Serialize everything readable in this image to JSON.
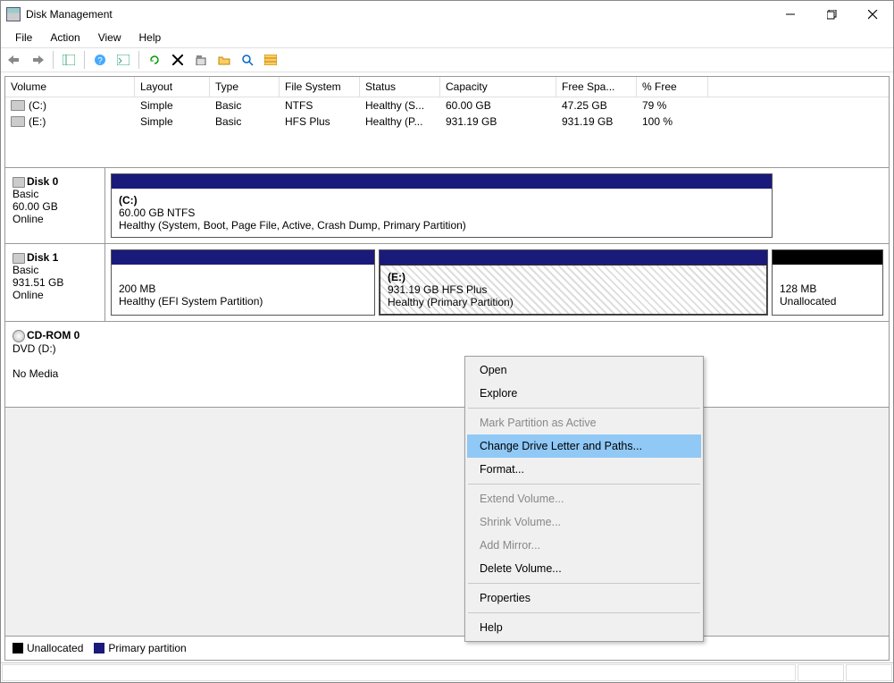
{
  "title": "Disk Management",
  "menu": {
    "file": "File",
    "action": "Action",
    "view": "View",
    "help": "Help"
  },
  "cols": {
    "volume": "Volume",
    "layout": "Layout",
    "type": "Type",
    "fs": "File System",
    "status": "Status",
    "capacity": "Capacity",
    "free": "Free Spa...",
    "pfree": "% Free"
  },
  "vols": [
    {
      "name": "(C:)",
      "layout": "Simple",
      "type": "Basic",
      "fs": "NTFS",
      "status": "Healthy (S...",
      "cap": "60.00 GB",
      "free": "47.25 GB",
      "pfree": "79 %"
    },
    {
      "name": "(E:)",
      "layout": "Simple",
      "type": "Basic",
      "fs": "HFS Plus",
      "status": "Healthy (P...",
      "cap": "931.19 GB",
      "free": "931.19 GB",
      "pfree": "100 %"
    }
  ],
  "disk0": {
    "title": "Disk 0",
    "type": "Basic",
    "size": "60.00 GB",
    "state": "Online",
    "p0_name": "(C:)",
    "p0_size": "60.00 GB NTFS",
    "p0_status": "Healthy (System, Boot, Page File, Active, Crash Dump, Primary Partition)"
  },
  "disk1": {
    "title": "Disk 1",
    "type": "Basic",
    "size": "931.51 GB",
    "state": "Online",
    "p0_size": "200 MB",
    "p0_status": "Healthy (EFI System Partition)",
    "p1_name": "(E:)",
    "p1_size": "931.19 GB HFS Plus",
    "p1_status": "Healthy (Primary Partition)",
    "p2_size": "128 MB",
    "p2_status": "Unallocated"
  },
  "cdrom": {
    "title": "CD-ROM 0",
    "type": "DVD (D:)",
    "state": "No Media"
  },
  "legend": {
    "unalloc": "Unallocated",
    "primary": "Primary partition"
  },
  "ctx": {
    "open": "Open",
    "explore": "Explore",
    "mark": "Mark Partition as Active",
    "change": "Change Drive Letter and Paths...",
    "format": "Format...",
    "extend": "Extend Volume...",
    "shrink": "Shrink Volume...",
    "mirror": "Add Mirror...",
    "delete": "Delete Volume...",
    "props": "Properties",
    "help": "Help"
  }
}
